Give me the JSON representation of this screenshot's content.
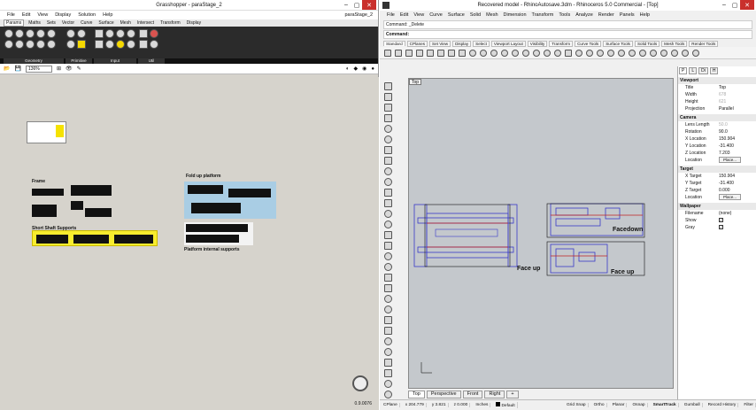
{
  "grasshopper": {
    "title": "Grasshopper - paraStage_2",
    "doc_name": "paraStage_2",
    "menu": [
      "File",
      "Edit",
      "View",
      "Display",
      "Solution",
      "Help"
    ],
    "tabs": [
      "Params",
      "Maths",
      "Sets",
      "Vector",
      "Curve",
      "Surface",
      "Mesh",
      "Intersect",
      "Transform",
      "Display"
    ],
    "ribbon_groups": [
      "Geometry",
      "Primitive",
      "Input",
      "Util"
    ],
    "zoom": "136%",
    "status": "0.9.0076",
    "groups": {
      "frame": "Frame",
      "short_shaft": "Short Shaft Supports",
      "fold_up": "Fold up platform",
      "platform_internal": "Platform internal supports"
    }
  },
  "rhino": {
    "title": "Recovered model - RhinoAutosave.3dm - Rhinoceros 5.0 Commercial - [Top]",
    "menu": [
      "File",
      "Edit",
      "View",
      "Curve",
      "Surface",
      "Solid",
      "Mesh",
      "Dimension",
      "Transform",
      "Tools",
      "Analyze",
      "Render",
      "Panels",
      "Help"
    ],
    "command_history": "Command: _Delete",
    "command_prompt": "Command:",
    "toolbar_tabs": [
      "Standard",
      "CPlanes",
      "Set View",
      "Display",
      "Select",
      "Viewport Layout",
      "Visibility",
      "Transform",
      "Curve Tools",
      "Surface Tools",
      "Solid Tools",
      "Mesh Tools",
      "Render Tools"
    ],
    "viewport_label": "Top",
    "viewport_tabs": [
      "Top",
      "Perspective",
      "Front",
      "Right"
    ],
    "annotations": [
      "Face up",
      "Facedown",
      "Face up"
    ],
    "panel": {
      "tabs": [
        "P",
        "L",
        "Di",
        "H"
      ],
      "viewport": {
        "heading": "Viewport",
        "rows": [
          {
            "k": "Title",
            "v": "Top"
          },
          {
            "k": "Width",
            "v": "678",
            "dim": true
          },
          {
            "k": "Height",
            "v": "621",
            "dim": true
          },
          {
            "k": "Projection",
            "v": "Parallel"
          }
        ]
      },
      "camera": {
        "heading": "Camera",
        "rows": [
          {
            "k": "Lens Length",
            "v": "50.0",
            "dim": true
          },
          {
            "k": "Rotation",
            "v": "90.0"
          },
          {
            "k": "X Location",
            "v": "150.904"
          },
          {
            "k": "Y Location",
            "v": "-31.400"
          },
          {
            "k": "Z Location",
            "v": "7.203"
          },
          {
            "k": "Location",
            "v": "Place..."
          }
        ]
      },
      "target": {
        "heading": "Target",
        "rows": [
          {
            "k": "X Target",
            "v": "150.904"
          },
          {
            "k": "Y Target",
            "v": "-31.400"
          },
          {
            "k": "Z Target",
            "v": "0.000"
          },
          {
            "k": "Location",
            "v": "Place..."
          }
        ]
      },
      "wallpaper": {
        "heading": "Wallpaper",
        "rows": [
          {
            "k": "Filename",
            "v": "(none)"
          },
          {
            "k": "Show",
            "v": "✓"
          },
          {
            "k": "Gray",
            "v": "✓"
          }
        ]
      }
    },
    "status": {
      "cplane": "CPlane",
      "x": "x 204.779",
      "y": "y 3.821",
      "z": "z 0.000",
      "units": "Inches",
      "layer": "Default",
      "toggles": [
        "Grid Snap",
        "Ortho",
        "Planar",
        "Osnap",
        "SmartTrack",
        "Gumball",
        "Record History",
        "Filter"
      ]
    }
  }
}
